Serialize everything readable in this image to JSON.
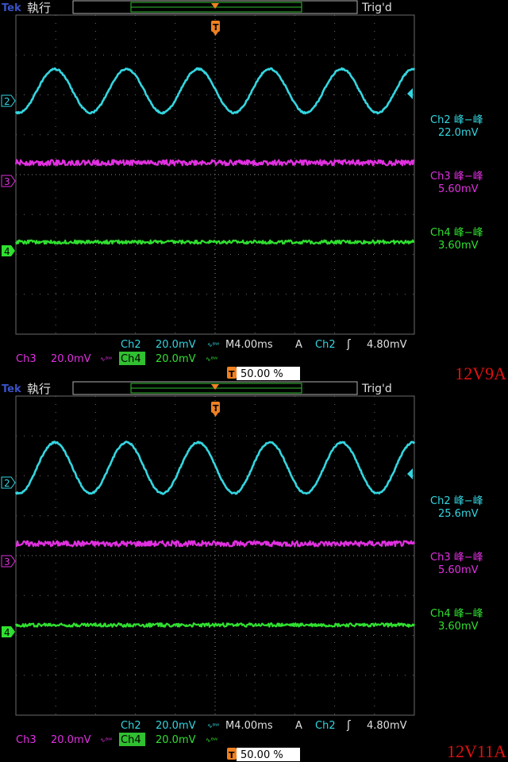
{
  "colors": {
    "ch2": "#33d6e0",
    "ch3": "#e030e0",
    "ch4": "#30e030",
    "trigger": "#f08020",
    "grid": "#6a6a6a"
  },
  "chart_data": [
    {
      "type": "line",
      "label": "12V9A",
      "brand": "Tek",
      "mode": "執行",
      "trig_status": "Trig'd",
      "markers": {
        "ch2": "2",
        "ch3": "3",
        "ch4": "4",
        "trigger": "T"
      },
      "measurements": [
        {
          "name": "Ch2 峰−峰",
          "value": "22.0mV"
        },
        {
          "name": "Ch3 峰−峰",
          "value": "5.60mV"
        },
        {
          "name": "Ch4 峰−峰",
          "value": "3.60mV"
        }
      ],
      "settings": {
        "ch2_label": "Ch2",
        "ch2_scale": "20.0mV",
        "ch3_label": "Ch3",
        "ch3_scale": "20.0mV",
        "ch4_label": "Ch4",
        "ch4_scale": "20.0mV",
        "timebase": "M4.00ms",
        "trig_mode": "A",
        "trig_source": "Ch2",
        "trig_level": "4.80mV",
        "trig_position": "50.00 %"
      },
      "xlim": [
        -20,
        20
      ],
      "ylim": [
        -80,
        80
      ],
      "x_unit": "ms",
      "series": [
        {
          "channel": "Ch2",
          "offset_mv": 42,
          "amplitude_mv": 11.0,
          "period_ms": 7.2,
          "phase_ms": -3.5
        },
        {
          "channel": "Ch3",
          "offset_mv": 6,
          "amplitude_mv": 2.8,
          "period_ms": 0,
          "phase_ms": 0
        },
        {
          "channel": "Ch4",
          "offset_mv": -32,
          "amplitude_mv": 1.8,
          "period_ms": 0,
          "phase_ms": 0
        }
      ]
    },
    {
      "type": "line",
      "label": "12V11A",
      "brand": "Tek",
      "mode": "執行",
      "trig_status": "Trig'd",
      "markers": {
        "ch2": "2",
        "ch3": "3",
        "ch4": "4",
        "trigger": "T"
      },
      "measurements": [
        {
          "name": "Ch2 峰−峰",
          "value": "25.6mV"
        },
        {
          "name": "Ch3 峰−峰",
          "value": "5.60mV"
        },
        {
          "name": "Ch4 峰−峰",
          "value": "3.60mV"
        }
      ],
      "settings": {
        "ch2_label": "Ch2",
        "ch2_scale": "20.0mV",
        "ch3_label": "Ch3",
        "ch3_scale": "20.0mV",
        "ch4_label": "Ch4",
        "ch4_scale": "20.0mV",
        "timebase": "M4.00ms",
        "trig_mode": "A",
        "trig_source": "Ch2",
        "trig_level": "4.80mV",
        "trig_position": "50.00 %"
      },
      "xlim": [
        -20,
        20
      ],
      "ylim": [
        -80,
        80
      ],
      "x_unit": "ms",
      "series": [
        {
          "channel": "Ch2",
          "offset_mv": 44,
          "amplitude_mv": 12.8,
          "period_ms": 7.2,
          "phase_ms": -3.5
        },
        {
          "channel": "Ch3",
          "offset_mv": 6,
          "amplitude_mv": 2.8,
          "period_ms": 0,
          "phase_ms": 0
        },
        {
          "channel": "Ch4",
          "offset_mv": -33,
          "amplitude_mv": 1.8,
          "period_ms": 0,
          "phase_ms": 0
        }
      ]
    }
  ]
}
